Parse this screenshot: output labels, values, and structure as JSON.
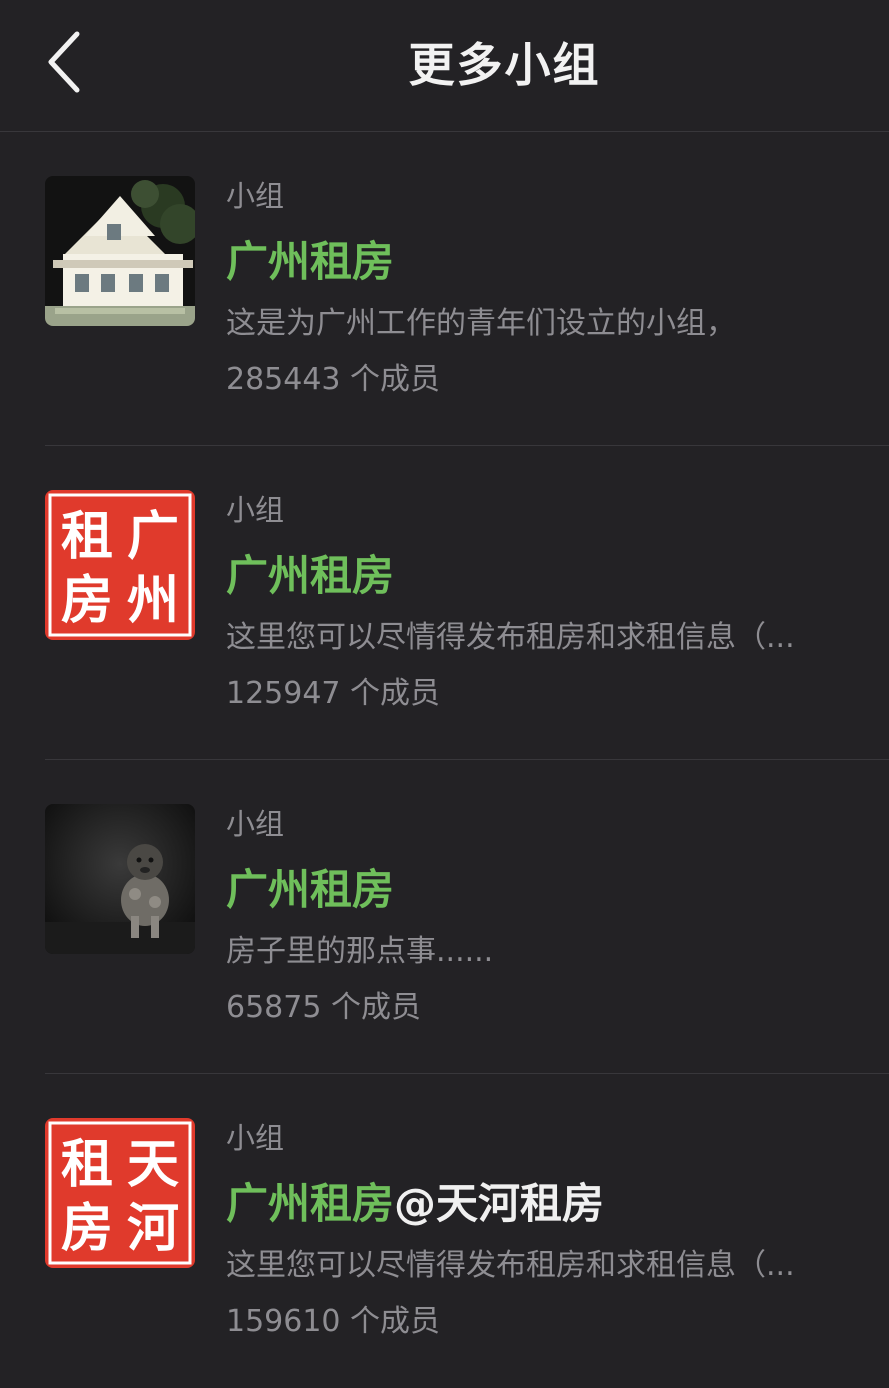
{
  "header": {
    "title": "更多小组",
    "back_icon": "chevron-left-icon"
  },
  "colors": {
    "background": "#232225",
    "accent_green": "#6fbf5b",
    "seal_red": "#e03a2c",
    "secondary_text": "#8e8d92"
  },
  "groups": [
    {
      "type": "小组",
      "name_highlight": "广州租房",
      "name_rest": "",
      "description": "这是为广州工作的青年们设立的小组，",
      "members": "285443 个成员",
      "avatar": "house-photo"
    },
    {
      "type": "小组",
      "name_highlight": "广州租房",
      "name_rest": "",
      "description": "这里您可以尽情得发布租房和求租信息（...",
      "members": "125947 个成员",
      "avatar": "red-seal",
      "seal_chars": [
        "广",
        "州",
        "租",
        "房"
      ]
    },
    {
      "type": "小组",
      "name_highlight": "广州租房",
      "name_rest": "",
      "description": "房子里的那点事......",
      "members": "65875 个成员",
      "avatar": "dog-photo"
    },
    {
      "type": "小组",
      "name_highlight": "广州租房",
      "name_rest": "@天河租房",
      "description": "这里您可以尽情得发布租房和求租信息（...",
      "members": "159610 个成员",
      "avatar": "red-seal",
      "seal_chars": [
        "天",
        "河",
        "租",
        "房"
      ]
    }
  ]
}
